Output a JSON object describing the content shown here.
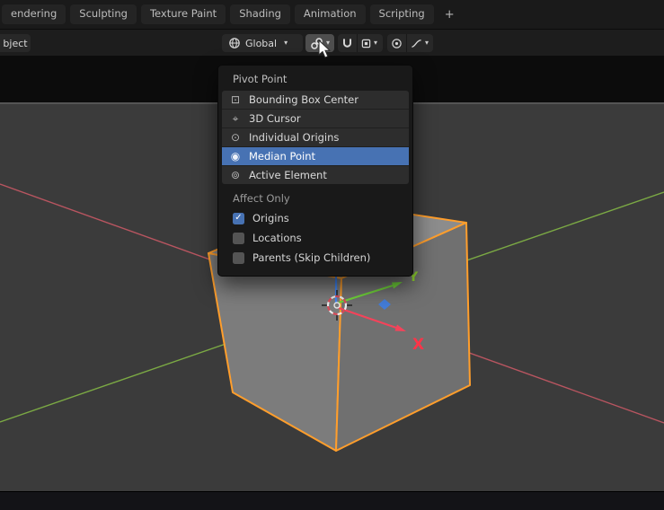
{
  "topbar": {
    "tabs": [
      "endering",
      "Sculpting",
      "Texture Paint",
      "Shading",
      "Animation",
      "Scripting"
    ],
    "add_tab_label": "+"
  },
  "viewport_header": {
    "mode_button_label": "bject",
    "orientation_label": "Global",
    "caret_glyph": "▾"
  },
  "pivot_menu": {
    "title": "Pivot Point",
    "items": [
      {
        "icon": "⊡",
        "label": "Bounding Box Center"
      },
      {
        "icon": "⌖",
        "label": "3D Cursor"
      },
      {
        "icon": "⊙",
        "label": "Individual Origins"
      },
      {
        "icon": "◉",
        "label": "Median Point"
      },
      {
        "icon": "⊚",
        "label": "Active Element"
      }
    ],
    "selected_item": "Median Point",
    "section_title": "Affect Only",
    "checkboxes": [
      {
        "label": "Origins",
        "checked": true
      },
      {
        "label": "Locations",
        "checked": false
      },
      {
        "label": "Parents (Skip Children)",
        "checked": false
      }
    ],
    "check_glyph": "✓"
  },
  "viewport": {
    "axis_x_label": "X",
    "axis_y_label": "Y"
  },
  "colors": {
    "selection_accent": "#4772b3",
    "object_outline": "#ff9e2c",
    "axis_x_line": "#b85560",
    "axis_y_line": "#7ba944",
    "gizmo_x": "#f4435a",
    "gizmo_y": "#6fd13a",
    "gizmo_z": "#4186f4"
  }
}
